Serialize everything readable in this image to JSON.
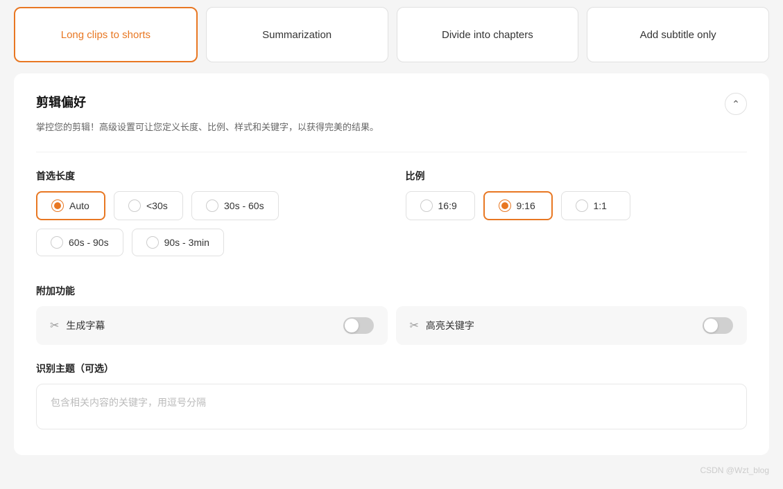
{
  "tabs": [
    {
      "id": "long-clips",
      "label": "Long clips to shorts",
      "active": true
    },
    {
      "id": "summarization",
      "label": "Summarization",
      "active": false
    },
    {
      "id": "divide-chapters",
      "label": "Divide into chapters",
      "active": false
    },
    {
      "id": "add-subtitle",
      "label": "Add subtitle only",
      "active": false
    }
  ],
  "panel": {
    "title": "剪辑偏好",
    "description": "掌控您的剪辑！高级设置可让您定义长度、比例、样式和关键字，以获得完美的结果。",
    "sections": {
      "preferred_length": {
        "label": "首选长度",
        "options": [
          {
            "id": "auto",
            "label": "Auto",
            "selected": true
          },
          {
            "id": "lt30",
            "label": "<30s",
            "selected": false
          },
          {
            "id": "30-60",
            "label": "30s - 60s",
            "selected": false
          },
          {
            "id": "60-90",
            "label": "60s - 90s",
            "selected": false
          },
          {
            "id": "90-3min",
            "label": "90s - 3min",
            "selected": false
          }
        ]
      },
      "ratio": {
        "label": "比例",
        "options": [
          {
            "id": "16-9",
            "label": "16:9",
            "selected": false
          },
          {
            "id": "9-16",
            "label": "9:16",
            "selected": true
          },
          {
            "id": "1-1",
            "label": "1:1",
            "selected": false
          }
        ]
      },
      "additional": {
        "label": "附加功能",
        "features": [
          {
            "id": "subtitles",
            "icon": "✂️",
            "label": "生成字幕",
            "enabled": false
          },
          {
            "id": "highlight",
            "icon": "✂️",
            "label": "高亮关键字",
            "enabled": false
          }
        ]
      },
      "topic": {
        "label": "识别主题（可选）",
        "placeholder": "包含相关内容的关键字，用逗号分隔"
      }
    }
  },
  "watermark": "CSDN @Wzt_blog"
}
